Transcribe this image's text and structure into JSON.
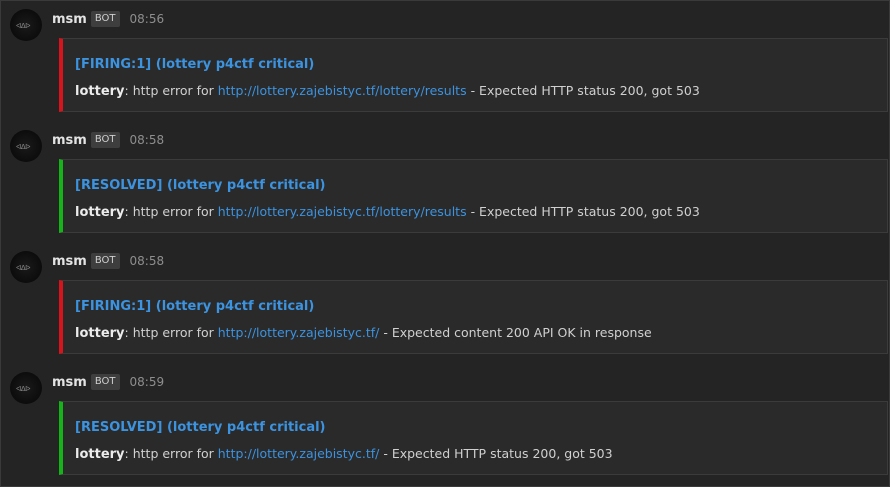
{
  "messages": [
    {
      "author": "msm",
      "badge": "BOT",
      "time": "08:56",
      "embed": {
        "color": "#d7141b",
        "title": "[FIRING:1] (lottery p4ctf critical)",
        "name": "lottery",
        "prefix": ": http error for ",
        "url": "http://lottery.zajebistyc.tf/lottery/results",
        "suffix": " - Expected HTTP status 200, got 503"
      }
    },
    {
      "author": "msm",
      "badge": "BOT",
      "time": "08:58",
      "embed": {
        "color": "#15b21a",
        "title": "[RESOLVED] (lottery p4ctf critical)",
        "name": "lottery",
        "prefix": ": http error for ",
        "url": "http://lottery.zajebistyc.tf/lottery/results",
        "suffix": " - Expected HTTP status 200, got 503"
      }
    },
    {
      "author": "msm",
      "badge": "BOT",
      "time": "08:58",
      "embed": {
        "color": "#d7141b",
        "title": "[FIRING:1] (lottery p4ctf critical)",
        "name": "lottery",
        "prefix": ": http error for ",
        "url": "http://lottery.zajebistyc.tf/",
        "suffix": " - Expected content 200 API OK in response"
      }
    },
    {
      "author": "msm",
      "badge": "BOT",
      "time": "08:59",
      "embed": {
        "color": "#15b21a",
        "title": "[RESOLVED] (lottery p4ctf critical)",
        "name": "lottery",
        "prefix": ": http error for ",
        "url": "http://lottery.zajebistyc.tf/",
        "suffix": " - Expected HTTP status 200, got 503"
      }
    }
  ]
}
